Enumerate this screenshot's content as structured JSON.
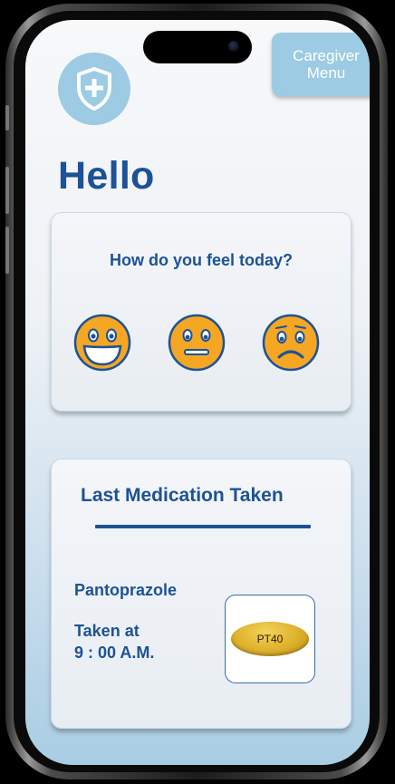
{
  "header": {
    "caregiver_line1": "Caregiver",
    "caregiver_line2": "Menu",
    "logo_icon": "shield-plus-icon"
  },
  "greeting": "Hello",
  "mood_card": {
    "question": "How do you feel today?",
    "moods": [
      {
        "icon": "happy-face-icon"
      },
      {
        "icon": "neutral-face-icon"
      },
      {
        "icon": "sad-face-icon"
      }
    ]
  },
  "medication_card": {
    "title": "Last Medication Taken",
    "name": "Pantoprazole",
    "taken_label": "Taken at",
    "taken_time": "9 : 00 A.M.",
    "pill_imprint": "PT40"
  },
  "colors": {
    "primary": "#1d5296",
    "accent": "#9ccbe3",
    "face": "#f5a623"
  }
}
